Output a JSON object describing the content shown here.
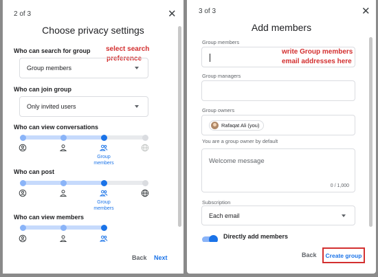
{
  "left": {
    "step": "2 of 3",
    "title": "Choose privacy settings",
    "search_label": "Who can search for group",
    "search_value": "Group members",
    "annotation1": "select search",
    "annotation2": "preference",
    "join_label": "Who can join group",
    "join_value": "Only invited users",
    "sections": [
      {
        "label": "Who can view conversations",
        "selected": 3,
        "enabled": 3,
        "icons": [
          "globe-icon-muted"
        ]
      },
      {
        "label": "Who can post",
        "selected": 3,
        "enabled": 4
      },
      {
        "label": "Who can view members",
        "selected": 3,
        "enabled": 3
      }
    ],
    "sublabel_1": "Group",
    "sublabel_2": "members",
    "back": "Back",
    "next": "Next"
  },
  "right": {
    "step": "3 of 3",
    "title": "Add members",
    "members_label": "Group members",
    "annotation1": "write Group members",
    "annotation2": "email addresses here",
    "managers_label": "Group managers",
    "owners_label": "Group owners",
    "owner_chip": "Rafaqat Ali (you)",
    "owner_note": "You are a group owner by default",
    "welcome_placeholder": "Welcome message",
    "welcome_counter": "0 / 1,000",
    "subscription_label": "Subscription",
    "subscription_value": "Each email",
    "direct_add_label": "Directly add members",
    "back": "Back",
    "create": "Create group"
  },
  "colors": {
    "accent": "#1a73e8",
    "annotation": "#d32f2f",
    "track_fill": "#c6dafc"
  }
}
